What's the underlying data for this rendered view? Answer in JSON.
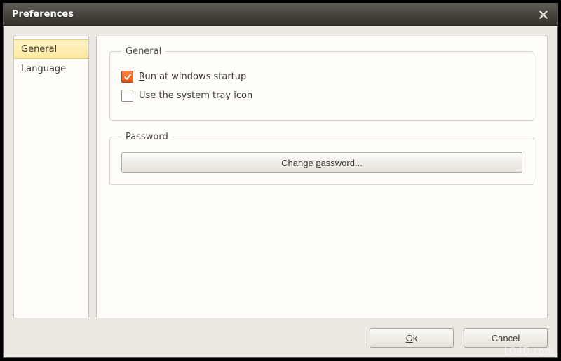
{
  "window": {
    "title": "Preferences"
  },
  "sidebar": {
    "tabs": [
      {
        "label": "General",
        "selected": true
      },
      {
        "label": "Language",
        "selected": false
      }
    ]
  },
  "groups": {
    "general": {
      "legend": "General",
      "options": {
        "run_startup": {
          "prefix": "",
          "mn": "R",
          "suffix": "un at windows startup",
          "checked": true
        },
        "tray_icon": {
          "text": "Use the system tray icon",
          "checked": false
        }
      }
    },
    "password": {
      "legend": "Password",
      "button": {
        "prefix": "Change ",
        "mn": "p",
        "suffix": "assword..."
      }
    }
  },
  "footer": {
    "ok": {
      "mn": "O",
      "suffix": "k"
    },
    "cancel": {
      "text": "Cancel"
    }
  },
  "watermark": "LO4D.com"
}
